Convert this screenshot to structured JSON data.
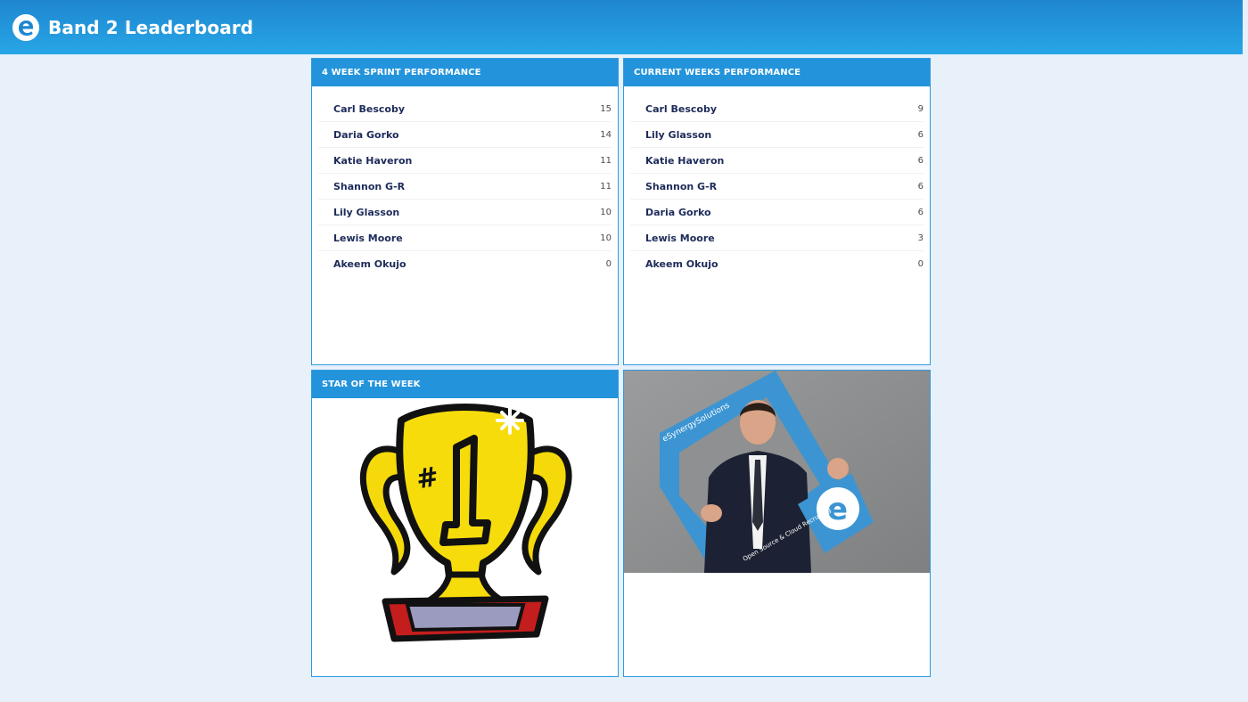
{
  "header": {
    "title": "Band 2 Leaderboard",
    "logo_icon": "esynergy-e-logo-icon"
  },
  "sprint_panel": {
    "title": "4 WEEK SPRINT PERFORMANCE",
    "rows": [
      {
        "name": "Carl Bescoby",
        "score": "15"
      },
      {
        "name": "Daria Gorko",
        "score": "14"
      },
      {
        "name": "Katie Haveron",
        "score": "11"
      },
      {
        "name": "Shannon G-R",
        "score": "11"
      },
      {
        "name": "Lily Glasson",
        "score": "10"
      },
      {
        "name": "Lewis Moore",
        "score": "10"
      },
      {
        "name": "Akeem Okujo",
        "score": "0"
      }
    ]
  },
  "week_panel": {
    "title": "CURRENT WEEKS PERFORMANCE",
    "rows": [
      {
        "name": "Carl Bescoby",
        "score": "9"
      },
      {
        "name": "Lily Glasson",
        "score": "6"
      },
      {
        "name": "Katie Haveron",
        "score": "6"
      },
      {
        "name": "Shannon G-R",
        "score": "6"
      },
      {
        "name": "Daria Gorko",
        "score": "6"
      },
      {
        "name": "Lewis Moore",
        "score": "3"
      },
      {
        "name": "Akeem Okujo",
        "score": "0"
      }
    ]
  },
  "star_panel": {
    "title": "STAR OF THE WEEK",
    "image": "trophy-number-one-icon",
    "trophy_text": "#1"
  },
  "photo_panel": {
    "image": "star-of-the-week-photo",
    "frame_brand": "eSynergySolutions",
    "frame_tagline": "Open Source & Cloud Recruiting"
  },
  "colors": {
    "header_bg": "#2394dc",
    "page_bg": "#e8f0fa",
    "name_text": "#1d2b5a"
  }
}
